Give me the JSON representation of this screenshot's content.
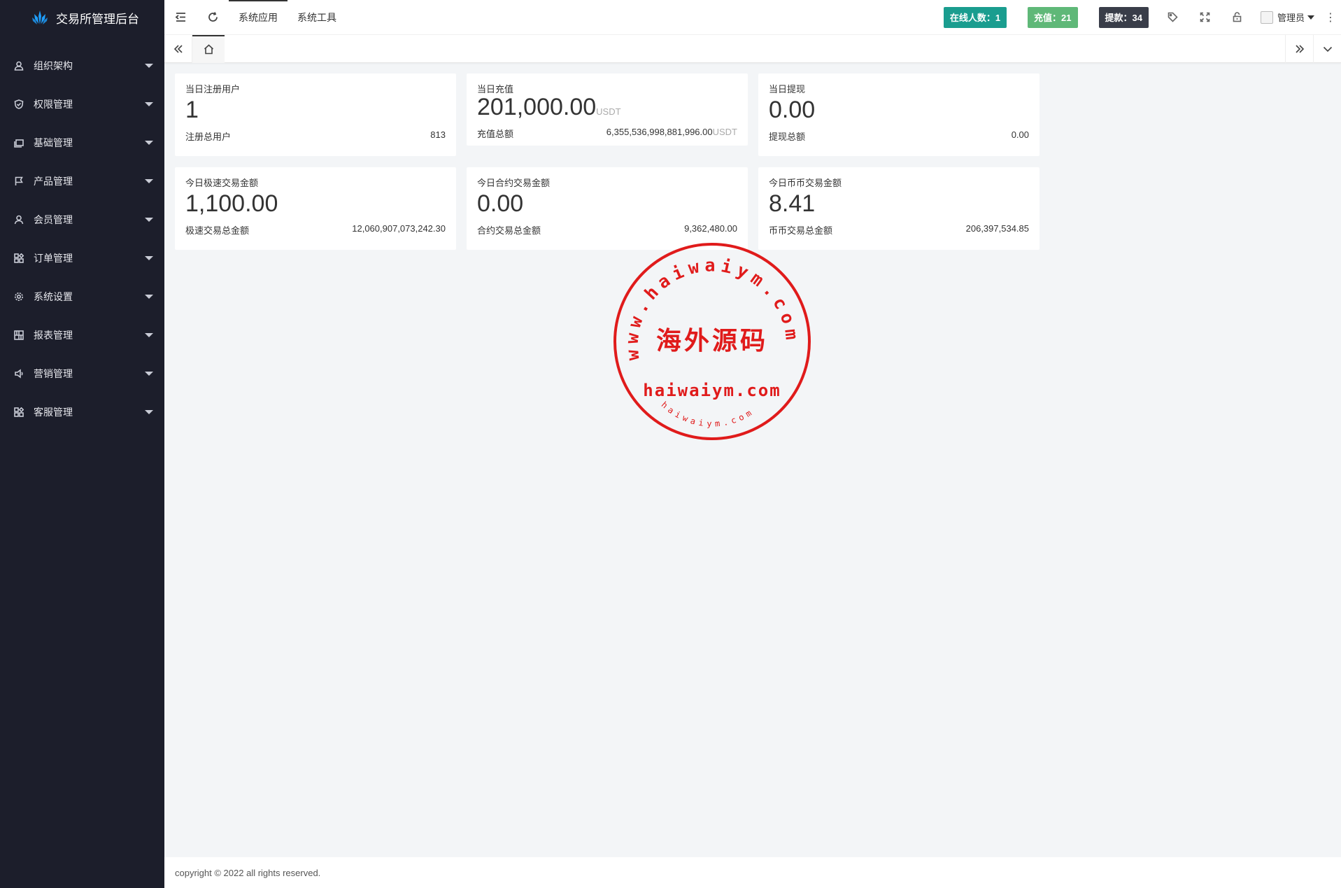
{
  "brand": {
    "title": "交易所管理后台",
    "accent": "#1e9fff"
  },
  "sidebar": {
    "items": [
      {
        "label": "组织架构",
        "icon": "user-icon"
      },
      {
        "label": "权限管理",
        "icon": "shield-icon"
      },
      {
        "label": "基础管理",
        "icon": "stack-icon"
      },
      {
        "label": "产品管理",
        "icon": "flag-icon"
      },
      {
        "label": "会员管理",
        "icon": "person-icon"
      },
      {
        "label": "订单管理",
        "icon": "apps-icon"
      },
      {
        "label": "系统设置",
        "icon": "gear-icon"
      },
      {
        "label": "报表管理",
        "icon": "grid-icon"
      },
      {
        "label": "营销管理",
        "icon": "speaker-icon"
      },
      {
        "label": "客服管理",
        "icon": "apps-icon"
      }
    ]
  },
  "topbar": {
    "links": [
      "系统应用",
      "系统工具"
    ],
    "badges": {
      "online": "在线人数：1",
      "recharge": "充值：21",
      "withdraw": "提款：34"
    },
    "user_name": "管理员",
    "more": "⋮"
  },
  "cards": [
    {
      "title": "当日注册用户",
      "value": "1",
      "unit": "",
      "footer_label": "注册总用户",
      "footer_value": "813",
      "footer_unit": ""
    },
    {
      "title": "当日充值",
      "value": "201,000.00",
      "unit": "USDT",
      "footer_label": "充值总额",
      "footer_value": "6,355,536,998,881,996.00",
      "footer_unit": "USDT"
    },
    {
      "title": "当日提现",
      "value": "0.00",
      "unit": "",
      "footer_label": "提现总额",
      "footer_value": "0.00",
      "footer_unit": ""
    },
    {
      "title": "今日极速交易金额",
      "value": "1,100.00",
      "unit": "",
      "footer_label": "极速交易总金额",
      "footer_value": "12,060,907,073,242.30",
      "footer_unit": ""
    },
    {
      "title": "今日合约交易金额",
      "value": "0.00",
      "unit": "",
      "footer_label": "合约交易总金额",
      "footer_value": "9,362,480.00",
      "footer_unit": ""
    },
    {
      "title": "今日币币交易金额",
      "value": "8.41",
      "unit": "",
      "footer_label": "币币交易总金额",
      "footer_value": "206,397,534.85",
      "footer_unit": ""
    }
  ],
  "watermark": {
    "arc_text": "www.haiwaiym.com",
    "center_text": "海外源码",
    "domain_text": "haiwaiym.com",
    "small_text": "haiwaiym.com",
    "color": "#e01b1b"
  },
  "footer": {
    "copyright": "copyright © 2022 all rights reserved."
  },
  "colors": {
    "sidebar_bg": "#1c1e2b",
    "badge_online": "#1a9d8f",
    "badge_recharge": "#5fb878",
    "badge_withdraw": "#393d49"
  }
}
